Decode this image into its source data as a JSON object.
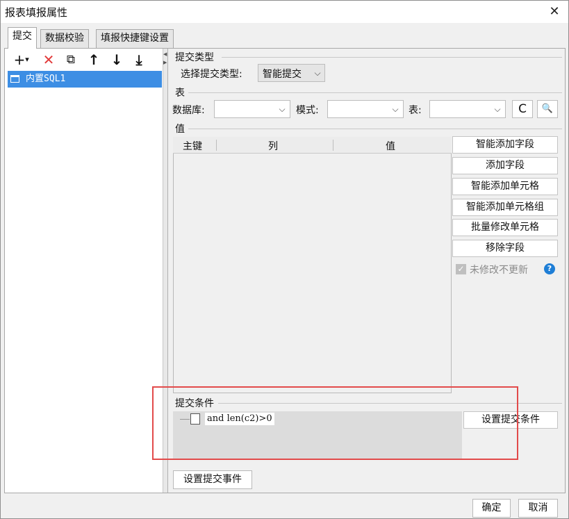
{
  "window": {
    "title": "报表填报属性",
    "close_glyph": "✕"
  },
  "tabs": [
    {
      "label": "提交",
      "active": true
    },
    {
      "label": "数据校验",
      "active": false
    },
    {
      "label": "填报快捷键设置",
      "active": false
    }
  ],
  "toolbar": {
    "add": "+",
    "add_dropdown": "▾",
    "delete": "✕",
    "copy": "⧉",
    "move_up": "↑",
    "move_down": "↓",
    "move_bottom": "⤓"
  },
  "tree": {
    "items": [
      {
        "label": "内置SQL1",
        "selected": true
      }
    ]
  },
  "submit_type": {
    "group_label": "提交类型",
    "select_label": "选择提交类型:",
    "selected_value": "智能提交"
  },
  "table_section": {
    "group_label": "表",
    "database_label": "数据库:",
    "database_value": "",
    "schema_label": "模式:",
    "schema_value": "",
    "table_label": "表:",
    "table_value": "",
    "refresh_icon": "C",
    "preview_icon": "🔍"
  },
  "values_section": {
    "group_label": "值",
    "columns": [
      "主键",
      "列",
      "值"
    ],
    "rows": []
  },
  "side_buttons": [
    "智能添加字段",
    "添加字段",
    "智能添加单元格",
    "智能添加单元格组",
    "批量修改单元格",
    "移除字段"
  ],
  "unmodified_no_update": {
    "label": "未修改不更新",
    "checked": true,
    "enabled": false
  },
  "submit_condition": {
    "group_label": "提交条件",
    "node_text": "and  len(c2)>0",
    "set_button": "设置提交条件"
  },
  "set_event_button": "设置提交事件",
  "footer": {
    "ok": "确定",
    "cancel": "取消"
  },
  "colors": {
    "selection": "#3d8ee4",
    "delete_red": "#e23b3b",
    "highlight_box": "#e24a4a",
    "help_blue": "#1e7ed6"
  }
}
